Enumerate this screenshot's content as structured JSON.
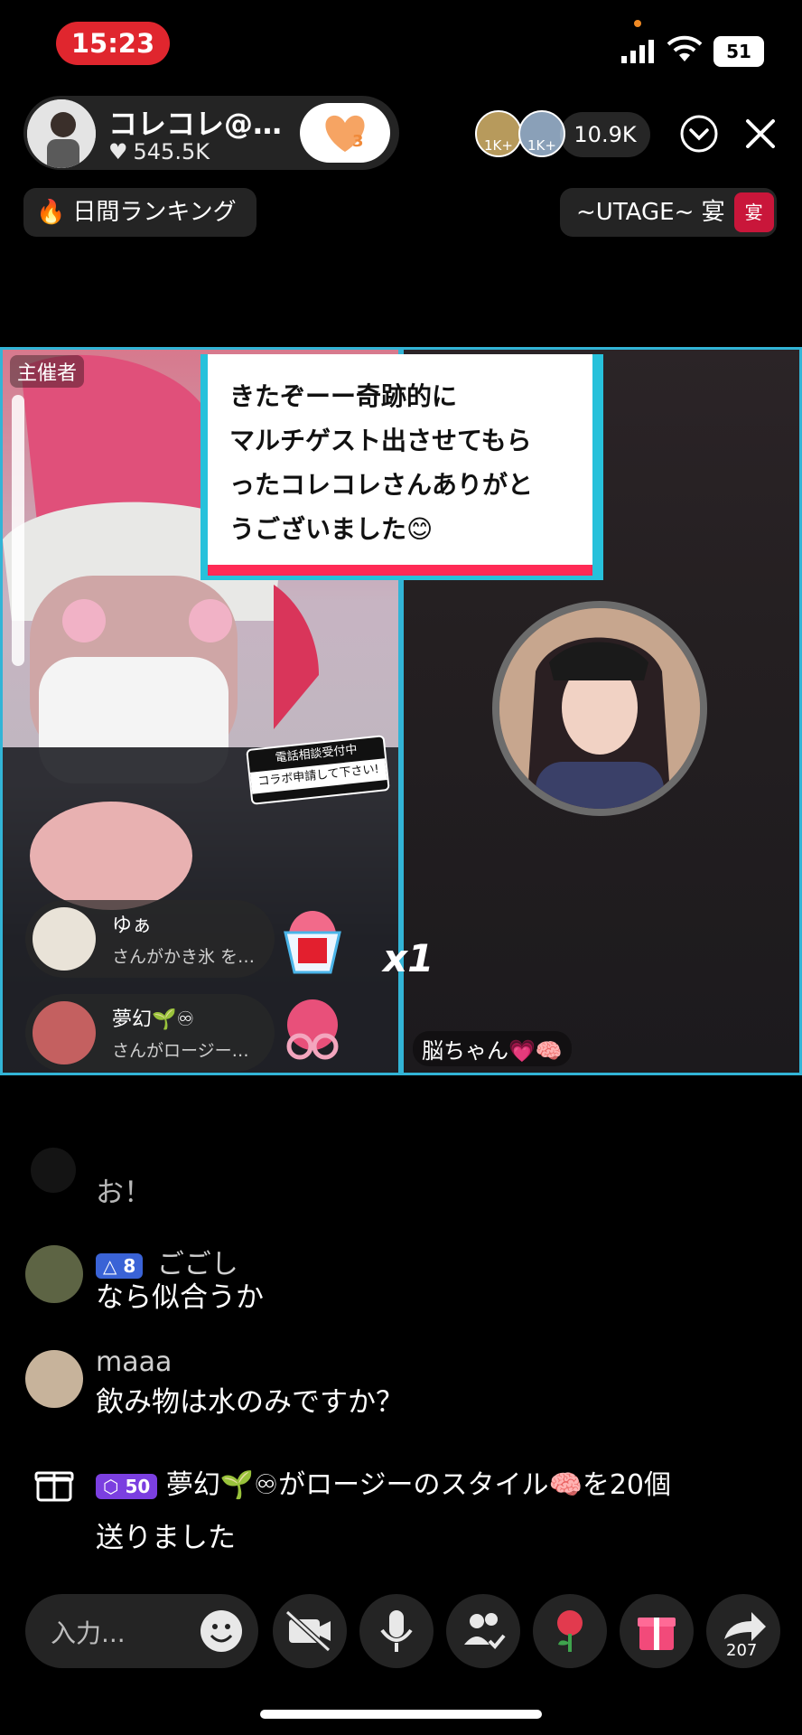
{
  "status_bar": {
    "time": "15:23",
    "battery": "51"
  },
  "host": {
    "name": "コレコレ@…",
    "likes": "545.5K",
    "follow_count": "3"
  },
  "viewers": {
    "badge1": "1K+",
    "badge2": "1K+",
    "count": "10.9K"
  },
  "tags": {
    "ranking": "日間ランキング",
    "event": "~UTAGE~ 宴",
    "event_mark": "宴"
  },
  "stream": {
    "organizer_label": "主催者",
    "quote_lines": [
      "きたぞーー奇跡的に",
      "マルチゲスト出させてもら",
      "ったコレコレさんありがと",
      "うございました😊"
    ],
    "sticker_line1": "電話相談受付中",
    "sticker_line2": "コラボ申請して下さい!",
    "guest_name": "脳ちゃん💗🧠",
    "gift_alerts": [
      {
        "user": "ゆぁ",
        "message": "さんがかき氷 を…",
        "multiplier": "x1"
      },
      {
        "user": "夢幻🌱♾",
        "message": "さんがロージー…"
      }
    ]
  },
  "chat": {
    "faded_line": "お！",
    "messages": [
      {
        "badge": "8",
        "user": "ごごし",
        "text": "なら似合うか"
      },
      {
        "badge": "",
        "user": "maaa",
        "text": "飲み物は水のみですか？"
      }
    ],
    "gift_message": {
      "badge": "50",
      "line1": "夢幻🌱♾がロージーのスタイル🧠を20個",
      "line2": "送りました"
    }
  },
  "bottom_bar": {
    "input_placeholder": "入力...",
    "share_count": "207"
  },
  "colors": {
    "time_pill": "#e0262e",
    "panel_border": "#32b4d6",
    "quote_accent": "#ff2a55",
    "badge_blue": "#3a63d6",
    "badge_purple": "#7b3fe0"
  }
}
